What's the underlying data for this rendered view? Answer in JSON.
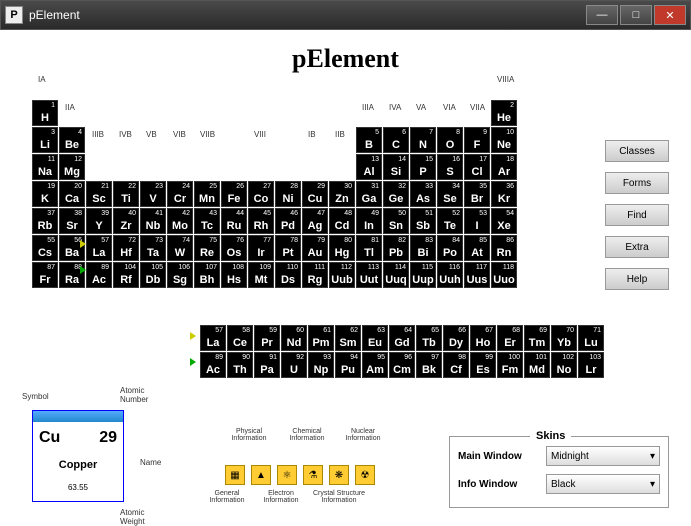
{
  "window": {
    "title": "pElement",
    "min": "—",
    "max": "□",
    "close": "✕"
  },
  "app_title": "pElement",
  "groups": [
    "IA",
    "IIA",
    "IIIB",
    "IVB",
    "VB",
    "VIB",
    "VIIB",
    "VIII",
    "IB",
    "IIB",
    "IIIA",
    "IVA",
    "VA",
    "VIA",
    "VIIA",
    "VIIIA"
  ],
  "elements": [
    {
      "n": 1,
      "s": "H",
      "r": 0,
      "c": 0
    },
    {
      "n": 2,
      "s": "He",
      "r": 0,
      "c": 17
    },
    {
      "n": 3,
      "s": "Li",
      "r": 1,
      "c": 0
    },
    {
      "n": 4,
      "s": "Be",
      "r": 1,
      "c": 1
    },
    {
      "n": 5,
      "s": "B",
      "r": 1,
      "c": 12
    },
    {
      "n": 6,
      "s": "C",
      "r": 1,
      "c": 13
    },
    {
      "n": 7,
      "s": "N",
      "r": 1,
      "c": 14
    },
    {
      "n": 8,
      "s": "O",
      "r": 1,
      "c": 15
    },
    {
      "n": 9,
      "s": "F",
      "r": 1,
      "c": 16
    },
    {
      "n": 10,
      "s": "Ne",
      "r": 1,
      "c": 17
    },
    {
      "n": 11,
      "s": "Na",
      "r": 2,
      "c": 0
    },
    {
      "n": 12,
      "s": "Mg",
      "r": 2,
      "c": 1
    },
    {
      "n": 13,
      "s": "Al",
      "r": 2,
      "c": 12
    },
    {
      "n": 14,
      "s": "Si",
      "r": 2,
      "c": 13
    },
    {
      "n": 15,
      "s": "P",
      "r": 2,
      "c": 14
    },
    {
      "n": 16,
      "s": "S",
      "r": 2,
      "c": 15
    },
    {
      "n": 17,
      "s": "Cl",
      "r": 2,
      "c": 16
    },
    {
      "n": 18,
      "s": "Ar",
      "r": 2,
      "c": 17
    },
    {
      "n": 19,
      "s": "K",
      "r": 3,
      "c": 0
    },
    {
      "n": 20,
      "s": "Ca",
      "r": 3,
      "c": 1
    },
    {
      "n": 21,
      "s": "Sc",
      "r": 3,
      "c": 2
    },
    {
      "n": 22,
      "s": "Ti",
      "r": 3,
      "c": 3
    },
    {
      "n": 23,
      "s": "V",
      "r": 3,
      "c": 4
    },
    {
      "n": 24,
      "s": "Cr",
      "r": 3,
      "c": 5
    },
    {
      "n": 25,
      "s": "Mn",
      "r": 3,
      "c": 6
    },
    {
      "n": 26,
      "s": "Fe",
      "r": 3,
      "c": 7
    },
    {
      "n": 27,
      "s": "Co",
      "r": 3,
      "c": 8
    },
    {
      "n": 28,
      "s": "Ni",
      "r": 3,
      "c": 9
    },
    {
      "n": 29,
      "s": "Cu",
      "r": 3,
      "c": 10
    },
    {
      "n": 30,
      "s": "Zn",
      "r": 3,
      "c": 11
    },
    {
      "n": 31,
      "s": "Ga",
      "r": 3,
      "c": 12
    },
    {
      "n": 32,
      "s": "Ge",
      "r": 3,
      "c": 13
    },
    {
      "n": 33,
      "s": "As",
      "r": 3,
      "c": 14
    },
    {
      "n": 34,
      "s": "Se",
      "r": 3,
      "c": 15
    },
    {
      "n": 35,
      "s": "Br",
      "r": 3,
      "c": 16
    },
    {
      "n": 36,
      "s": "Kr",
      "r": 3,
      "c": 17
    },
    {
      "n": 37,
      "s": "Rb",
      "r": 4,
      "c": 0
    },
    {
      "n": 38,
      "s": "Sr",
      "r": 4,
      "c": 1
    },
    {
      "n": 39,
      "s": "Y",
      "r": 4,
      "c": 2
    },
    {
      "n": 40,
      "s": "Zr",
      "r": 4,
      "c": 3
    },
    {
      "n": 41,
      "s": "Nb",
      "r": 4,
      "c": 4
    },
    {
      "n": 42,
      "s": "Mo",
      "r": 4,
      "c": 5
    },
    {
      "n": 43,
      "s": "Tc",
      "r": 4,
      "c": 6
    },
    {
      "n": 44,
      "s": "Ru",
      "r": 4,
      "c": 7
    },
    {
      "n": 45,
      "s": "Rh",
      "r": 4,
      "c": 8
    },
    {
      "n": 46,
      "s": "Pd",
      "r": 4,
      "c": 9
    },
    {
      "n": 47,
      "s": "Ag",
      "r": 4,
      "c": 10
    },
    {
      "n": 48,
      "s": "Cd",
      "r": 4,
      "c": 11
    },
    {
      "n": 49,
      "s": "In",
      "r": 4,
      "c": 12
    },
    {
      "n": 50,
      "s": "Sn",
      "r": 4,
      "c": 13
    },
    {
      "n": 51,
      "s": "Sb",
      "r": 4,
      "c": 14
    },
    {
      "n": 52,
      "s": "Te",
      "r": 4,
      "c": 15
    },
    {
      "n": 53,
      "s": "I",
      "r": 4,
      "c": 16
    },
    {
      "n": 54,
      "s": "Xe",
      "r": 4,
      "c": 17
    },
    {
      "n": 55,
      "s": "Cs",
      "r": 5,
      "c": 0
    },
    {
      "n": 56,
      "s": "Ba",
      "r": 5,
      "c": 1
    },
    {
      "n": 57,
      "s": "La",
      "r": 5,
      "c": 2
    },
    {
      "n": 72,
      "s": "Hf",
      "r": 5,
      "c": 3
    },
    {
      "n": 73,
      "s": "Ta",
      "r": 5,
      "c": 4
    },
    {
      "n": 74,
      "s": "W",
      "r": 5,
      "c": 5
    },
    {
      "n": 75,
      "s": "Re",
      "r": 5,
      "c": 6
    },
    {
      "n": 76,
      "s": "Os",
      "r": 5,
      "c": 7
    },
    {
      "n": 77,
      "s": "Ir",
      "r": 5,
      "c": 8
    },
    {
      "n": 78,
      "s": "Pt",
      "r": 5,
      "c": 9
    },
    {
      "n": 79,
      "s": "Au",
      "r": 5,
      "c": 10
    },
    {
      "n": 80,
      "s": "Hg",
      "r": 5,
      "c": 11
    },
    {
      "n": 81,
      "s": "Tl",
      "r": 5,
      "c": 12
    },
    {
      "n": 82,
      "s": "Pb",
      "r": 5,
      "c": 13
    },
    {
      "n": 83,
      "s": "Bi",
      "r": 5,
      "c": 14
    },
    {
      "n": 84,
      "s": "Po",
      "r": 5,
      "c": 15
    },
    {
      "n": 85,
      "s": "At",
      "r": 5,
      "c": 16
    },
    {
      "n": 86,
      "s": "Rn",
      "r": 5,
      "c": 17
    },
    {
      "n": 87,
      "s": "Fr",
      "r": 6,
      "c": 0
    },
    {
      "n": 88,
      "s": "Ra",
      "r": 6,
      "c": 1
    },
    {
      "n": 89,
      "s": "Ac",
      "r": 6,
      "c": 2
    },
    {
      "n": 104,
      "s": "Rf",
      "r": 6,
      "c": 3
    },
    {
      "n": 105,
      "s": "Db",
      "r": 6,
      "c": 4
    },
    {
      "n": 106,
      "s": "Sg",
      "r": 6,
      "c": 5
    },
    {
      "n": 107,
      "s": "Bh",
      "r": 6,
      "c": 6
    },
    {
      "n": 108,
      "s": "Hs",
      "r": 6,
      "c": 7
    },
    {
      "n": 109,
      "s": "Mt",
      "r": 6,
      "c": 8
    },
    {
      "n": 110,
      "s": "Ds",
      "r": 6,
      "c": 9
    },
    {
      "n": 111,
      "s": "Rg",
      "r": 6,
      "c": 10
    },
    {
      "n": 112,
      "s": "Uub",
      "r": 6,
      "c": 11
    },
    {
      "n": 113,
      "s": "Uut",
      "r": 6,
      "c": 12
    },
    {
      "n": 114,
      "s": "Uuq",
      "r": 6,
      "c": 13
    },
    {
      "n": 115,
      "s": "Uup",
      "r": 6,
      "c": 14
    },
    {
      "n": 116,
      "s": "Uuh",
      "r": 6,
      "c": 15
    },
    {
      "n": 117,
      "s": "Uus",
      "r": 6,
      "c": 16
    },
    {
      "n": 118,
      "s": "Uuo",
      "r": 6,
      "c": 17
    }
  ],
  "lanthanides": [
    {
      "n": 57,
      "s": "La"
    },
    {
      "n": 58,
      "s": "Ce"
    },
    {
      "n": 59,
      "s": "Pr"
    },
    {
      "n": 60,
      "s": "Nd"
    },
    {
      "n": 61,
      "s": "Pm"
    },
    {
      "n": 62,
      "s": "Sm"
    },
    {
      "n": 63,
      "s": "Eu"
    },
    {
      "n": 64,
      "s": "Gd"
    },
    {
      "n": 65,
      "s": "Tb"
    },
    {
      "n": 66,
      "s": "Dy"
    },
    {
      "n": 67,
      "s": "Ho"
    },
    {
      "n": 68,
      "s": "Er"
    },
    {
      "n": 69,
      "s": "Tm"
    },
    {
      "n": 70,
      "s": "Yb"
    },
    {
      "n": 71,
      "s": "Lu"
    }
  ],
  "actinides": [
    {
      "n": 89,
      "s": "Ac"
    },
    {
      "n": 90,
      "s": "Th"
    },
    {
      "n": 91,
      "s": "Pa"
    },
    {
      "n": 92,
      "s": "U"
    },
    {
      "n": 93,
      "s": "Np"
    },
    {
      "n": 94,
      "s": "Pu"
    },
    {
      "n": 95,
      "s": "Am"
    },
    {
      "n": 96,
      "s": "Cm"
    },
    {
      "n": 97,
      "s": "Bk"
    },
    {
      "n": 98,
      "s": "Cf"
    },
    {
      "n": 99,
      "s": "Es"
    },
    {
      "n": 100,
      "s": "Fm"
    },
    {
      "n": 101,
      "s": "Md"
    },
    {
      "n": 102,
      "s": "No"
    },
    {
      "n": 103,
      "s": "Lr"
    }
  ],
  "side_buttons": [
    "Classes",
    "Forms",
    "Find",
    "Extra",
    "Help"
  ],
  "legend": {
    "symbol": "Symbol",
    "atomic_number": "Atomic\nNumber",
    "name": "Name",
    "atomic_weight": "Atomic\nWeight"
  },
  "preview": {
    "symbol": "Cu",
    "number": "29",
    "name": "Copper",
    "weight": "63.55"
  },
  "info_icons": [
    {
      "label": "General\nInformation"
    },
    {
      "label": "Physical\nInformation"
    },
    {
      "label": "Electron\nInformation"
    },
    {
      "label": "Chemical\nInformation"
    },
    {
      "label": "Crystal Structure\nInformation"
    },
    {
      "label": "Nuclear\nInformation"
    }
  ],
  "skins": {
    "title": "Skins",
    "main_label": "Main Window",
    "main_value": "Midnight",
    "info_label": "Info Window",
    "info_value": "Black"
  }
}
